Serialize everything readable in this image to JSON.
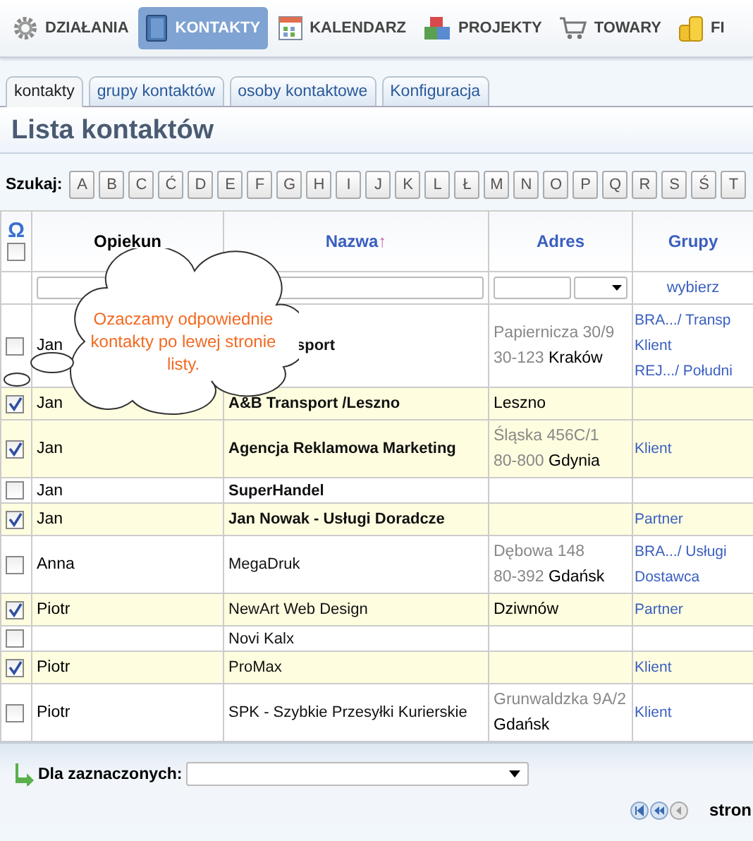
{
  "nav": [
    {
      "label": "DZIAŁANIA",
      "selected": false
    },
    {
      "label": "KONTAKTY",
      "selected": true
    },
    {
      "label": "KALENDARZ",
      "selected": false
    },
    {
      "label": "PROJEKTY",
      "selected": false
    },
    {
      "label": "TOWARY",
      "selected": false
    },
    {
      "label": "FI",
      "selected": false
    }
  ],
  "tabs": [
    {
      "label": "kontakty",
      "selected": true
    },
    {
      "label": "grupy kontaktów",
      "selected": false
    },
    {
      "label": "osoby kontaktowe",
      "selected": false
    },
    {
      "label": "Konfiguracja",
      "selected": false
    }
  ],
  "title": "Lista kontaktów",
  "search": {
    "label": "Szukaj:",
    "letters": [
      "A",
      "B",
      "C",
      "Ć",
      "D",
      "E",
      "F",
      "G",
      "H",
      "I",
      "J",
      "K",
      "L",
      "Ł",
      "M",
      "N",
      "O",
      "P",
      "Q",
      "R",
      "S",
      "Ś",
      "T"
    ]
  },
  "table": {
    "select_all_icon": "Ω",
    "select_all": false,
    "columns": [
      {
        "label": "Opiekun",
        "link": false
      },
      {
        "label": "Nazwa",
        "link": true,
        "sort": "↑"
      },
      {
        "label": "Adres",
        "link": true
      },
      {
        "label": "Grupy",
        "link": true
      }
    ],
    "groups_filter": "wybierz",
    "rows": [
      {
        "checked": false,
        "owner": "Jan",
        "name": "sport",
        "bold": true,
        "covered": true,
        "street": "Papiernicza 30/9",
        "postcode": "30-123",
        "city": "Kraków",
        "groups": [
          "BRA.../ Transp",
          "Klient",
          "REJ.../ Południ"
        ]
      },
      {
        "checked": true,
        "owner": "Jan",
        "name": "A&B Transport /Leszno",
        "bold": true,
        "city": "Leszno",
        "groups": []
      },
      {
        "checked": true,
        "owner": "Jan",
        "name": "Agencja Reklamowa Marketing",
        "bold": true,
        "street": "Śląska 456C/1",
        "postcode": "80-800",
        "city": "Gdynia",
        "groups": [
          "Klient"
        ]
      },
      {
        "checked": false,
        "owner": "Jan",
        "name": "SuperHandel",
        "bold": true,
        "groups": []
      },
      {
        "checked": true,
        "owner": "Jan",
        "name": "Jan Nowak - Usługi Doradcze",
        "bold": true,
        "groups": [
          "Partner"
        ]
      },
      {
        "checked": false,
        "owner": "Anna",
        "name": "MegaDruk",
        "bold": false,
        "street": "Dębowa 148",
        "postcode": "80-392",
        "city": "Gdańsk",
        "groups": [
          "BRA.../ Usługi",
          "Dostawca"
        ]
      },
      {
        "checked": true,
        "owner": "Piotr",
        "name": "NewArt Web Design",
        "bold": false,
        "city": "Dziwnów",
        "groups": [
          "Partner"
        ]
      },
      {
        "checked": false,
        "owner": "",
        "name": "Novi Kalx",
        "bold": false,
        "groups": []
      },
      {
        "checked": true,
        "owner": "Piotr",
        "name": "ProMax",
        "bold": false,
        "groups": [
          "Klient"
        ]
      },
      {
        "checked": false,
        "owner": "Piotr",
        "name": "SPK - Szybkie Przesyłki Kurierskie",
        "bold": false,
        "street": "Grunwaldzka 9A/2",
        "city": "Gdańsk",
        "groups": [
          "Klient"
        ]
      }
    ]
  },
  "callout": "Ozaczamy odpowiednie kontakty po lewej stronie listy.",
  "footer": {
    "label": "Dla zaznaczonych:",
    "pager_label": "stron"
  }
}
